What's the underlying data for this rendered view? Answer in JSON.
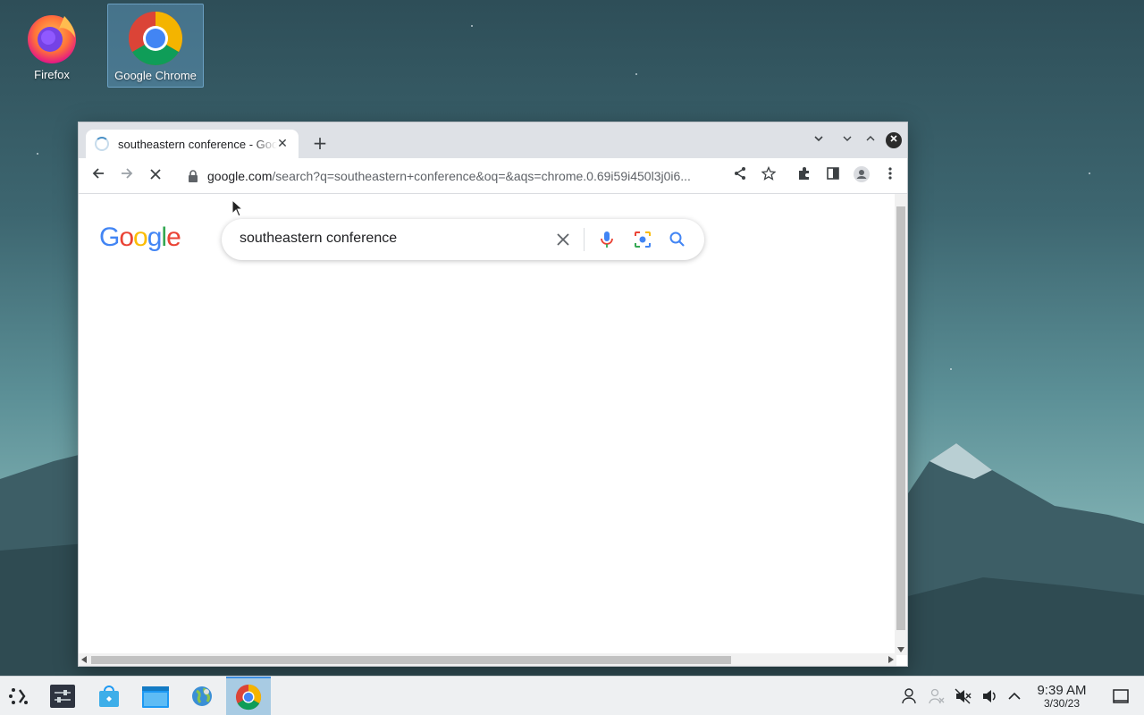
{
  "desktop": {
    "icons": [
      {
        "label": "Firefox"
      },
      {
        "label": "Google Chrome"
      }
    ]
  },
  "browser": {
    "tab": {
      "title": "southeastern conference - Google Search",
      "close": "✕"
    },
    "new_tab": "+",
    "url": {
      "host": "google.com",
      "path": "/search?q=southeastern+conference&oq=&aqs=chrome.0.69i59i450l3j0i6..."
    },
    "page": {
      "logo": "Google",
      "search": {
        "query": "southeastern conference"
      }
    }
  },
  "taskbar": {
    "clock": {
      "time": "9:39 AM",
      "date": "3/30/23"
    }
  },
  "colors": {
    "google_blue": "#4285f4",
    "google_red": "#ea4335",
    "google_yellow": "#fbbc05",
    "google_green": "#34a853",
    "taskbar_active": "#a8cbe3"
  }
}
